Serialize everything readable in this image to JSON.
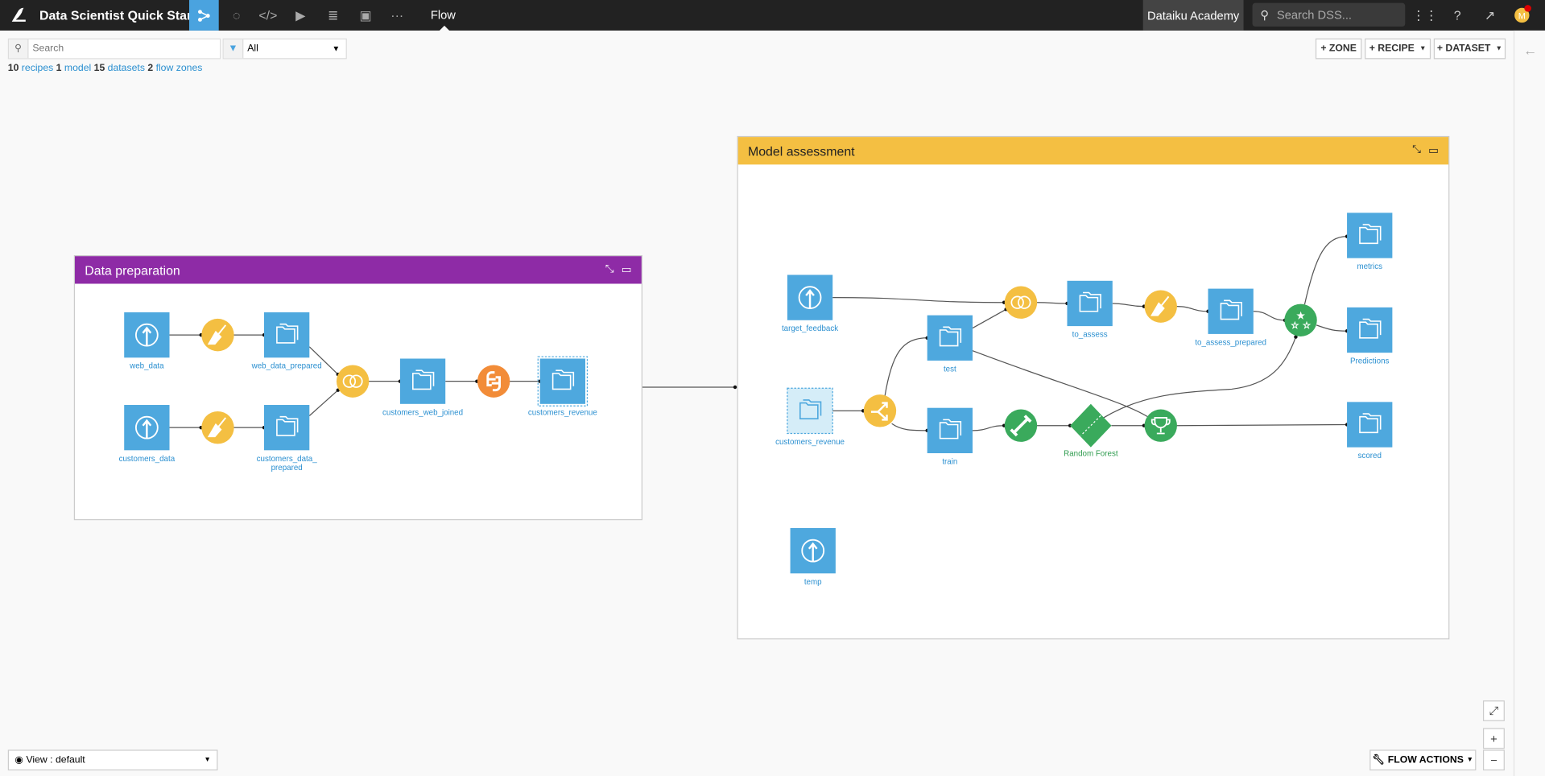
{
  "topbar": {
    "project_title": "Data Scientist Quick Start",
    "breadcrumb": "Flow",
    "instance": "Dataiku Academy",
    "search_placeholder": "Search DSS...",
    "avatar_initial": "M",
    "nav_icons": [
      "flow-icon",
      "lab-icon",
      "code-icon",
      "run-icon",
      "datasets-stack-icon",
      "dashboard-icon",
      "more-icon"
    ],
    "right_icons": [
      "apps-grid-icon",
      "help-icon",
      "activity-icon"
    ]
  },
  "toolbar": {
    "search_placeholder": "Search",
    "filter_value": "All",
    "counts": [
      {
        "n": "10",
        "label": "recipes"
      },
      {
        "n": "1",
        "label": "model"
      },
      {
        "n": "15",
        "label": "datasets"
      },
      {
        "n": "2",
        "label": "flow zones"
      }
    ],
    "zone_btn": "+ ZONE",
    "recipe_btn": "+ RECIPE",
    "dataset_btn": "+ DATASET"
  },
  "zones": [
    {
      "title": "Data preparation",
      "color": "#8e2ba6"
    },
    {
      "title": "Model assessment",
      "color": "#f4bf42"
    }
  ],
  "nodes": {
    "web_data": {
      "label": "web_data",
      "kind": "upload"
    },
    "prep1": {
      "kind": "prepare"
    },
    "web_data_prepared": {
      "label": "web_data_prepared",
      "kind": "dataset"
    },
    "customers_data": {
      "label": "customers_data",
      "kind": "upload"
    },
    "prep2": {
      "kind": "prepare"
    },
    "customers_data_prepared": {
      "label": "customers_data_",
      "label2": "prepared",
      "kind": "dataset"
    },
    "join1": {
      "kind": "join"
    },
    "customers_web_joined": {
      "label": "customers_web_joined",
      "kind": "dataset"
    },
    "python1": {
      "kind": "python"
    },
    "customers_revenue": {
      "label": "customers_revenue",
      "kind": "dataset",
      "selected": true
    },
    "target_feedback": {
      "label": "target_feedback",
      "kind": "upload"
    },
    "join2": {
      "kind": "join"
    },
    "to_assess": {
      "label": "to_assess",
      "kind": "dataset"
    },
    "prep3": {
      "kind": "prepare"
    },
    "to_assess_prepared": {
      "label": "to_assess_prepared",
      "kind": "dataset"
    },
    "evaluate": {
      "kind": "evaluate"
    },
    "metrics": {
      "label": "metrics",
      "kind": "dataset"
    },
    "predictions": {
      "label": "Predictions",
      "kind": "dataset"
    },
    "test": {
      "label": "test",
      "kind": "dataset"
    },
    "customers_revenue_shared": {
      "label": "customers_revenue",
      "kind": "shared"
    },
    "split": {
      "kind": "split"
    },
    "train": {
      "label": "train",
      "kind": "dataset"
    },
    "train_recipe": {
      "kind": "train"
    },
    "random_forest": {
      "label": "Random Forest",
      "kind": "model"
    },
    "score": {
      "kind": "score"
    },
    "scored": {
      "label": "scored",
      "kind": "dataset"
    },
    "temp": {
      "label": "temp",
      "kind": "upload"
    }
  },
  "colors": {
    "dataset": "#4ea8de",
    "prepare": "#f4bf42",
    "python": "#f28c38",
    "ml": "#3aaa5c",
    "shared": "#d5edf8"
  },
  "bottom": {
    "view_label": "View : default",
    "flow_actions": "FLOW ACTIONS"
  }
}
